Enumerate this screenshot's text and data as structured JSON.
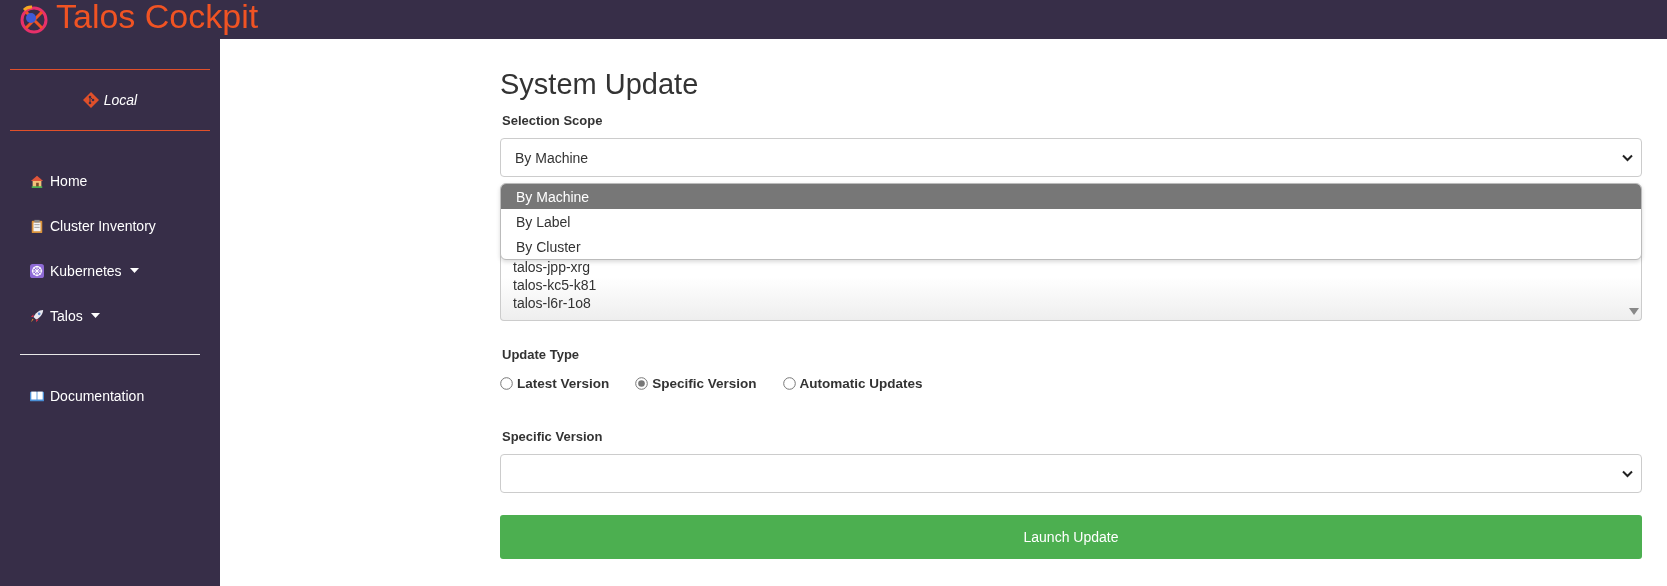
{
  "header": {
    "title": "Talos Cockpit"
  },
  "sidebar": {
    "context": "Local",
    "items": [
      {
        "label": "Home",
        "has_menu": false
      },
      {
        "label": "Cluster Inventory",
        "has_menu": false
      },
      {
        "label": "Kubernetes",
        "has_menu": true
      },
      {
        "label": "Talos",
        "has_menu": true
      }
    ],
    "footer_items": [
      {
        "label": "Documentation",
        "has_menu": false
      }
    ]
  },
  "page": {
    "title": "System Update",
    "scope": {
      "label": "Selection Scope",
      "value": "By Machine",
      "options": [
        {
          "label": "By Machine",
          "selected": true
        },
        {
          "label": "By Label",
          "selected": false
        },
        {
          "label": "By Cluster",
          "selected": false
        }
      ]
    },
    "machines": [
      "talos-jpp-xrg",
      "talos-kc5-k81",
      "talos-l6r-1o8"
    ],
    "update_type": {
      "label": "Update Type",
      "options": [
        {
          "label": "Latest Version",
          "selected": false
        },
        {
          "label": "Specific Version",
          "selected": true
        },
        {
          "label": "Automatic Updates",
          "selected": false
        }
      ]
    },
    "version": {
      "label": "Specific Version"
    },
    "launch_button": "Launch Update"
  }
}
